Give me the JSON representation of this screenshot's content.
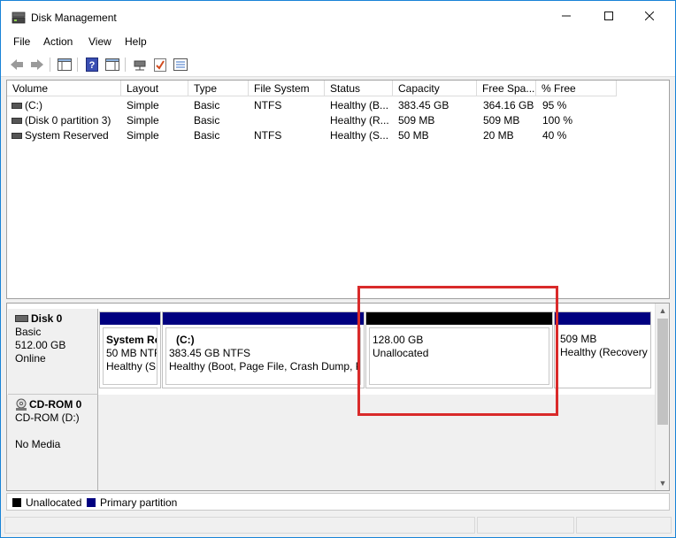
{
  "window": {
    "title": "Disk Management",
    "controls": {
      "minimize": "—",
      "maximize": "☐",
      "close": "✕"
    }
  },
  "menu": [
    "File",
    "Action",
    "View",
    "Help"
  ],
  "toolbar": {
    "icons": [
      "back-arrow-icon",
      "forward-arrow-icon",
      "console-tree-icon",
      "help-icon",
      "properties-pane-icon",
      "connect-icon",
      "check-icon",
      "settings-list-icon"
    ]
  },
  "volume_list": {
    "columns": [
      "Volume",
      "Layout",
      "Type",
      "File System",
      "Status",
      "Capacity",
      "Free Spa...",
      "% Free"
    ],
    "rows": [
      [
        "(C:)",
        "Simple",
        "Basic",
        "NTFS",
        "Healthy (B...",
        "383.45 GB",
        "364.16 GB",
        "95 %"
      ],
      [
        "(Disk 0 partition 3)",
        "Simple",
        "Basic",
        "",
        "Healthy (R...",
        "509 MB",
        "509 MB",
        "100 %"
      ],
      [
        "System Reserved",
        "Simple",
        "Basic",
        "NTFS",
        "Healthy (S...",
        "50 MB",
        "20 MB",
        "40 %"
      ]
    ]
  },
  "disks": {
    "disk0": {
      "name": "Disk 0",
      "type": "Basic",
      "size": "512.00 GB",
      "state": "Online",
      "partitions": [
        {
          "title": "System Re",
          "size": "50 MB NTF",
          "status": "Healthy (S",
          "kind": "primary"
        },
        {
          "title": "(C:)",
          "size": "383.45 GB NTFS",
          "status": "Healthy (Boot, Page File, Crash Dump, Pr",
          "kind": "primary"
        },
        {
          "title": "",
          "size": "128.00 GB",
          "status": "Unallocated",
          "kind": "unallocated"
        },
        {
          "title": "",
          "size": "509 MB",
          "status": "Healthy (Recovery",
          "kind": "primary"
        }
      ]
    },
    "cdrom0": {
      "name": "CD-ROM 0",
      "drive": "CD-ROM (D:)",
      "media": "No Media"
    }
  },
  "legend": {
    "unallocated": "Unallocated",
    "primary": "Primary partition"
  },
  "colors": {
    "primary": "#000080",
    "unallocated": "#000000",
    "highlight": "#d92a2a"
  }
}
